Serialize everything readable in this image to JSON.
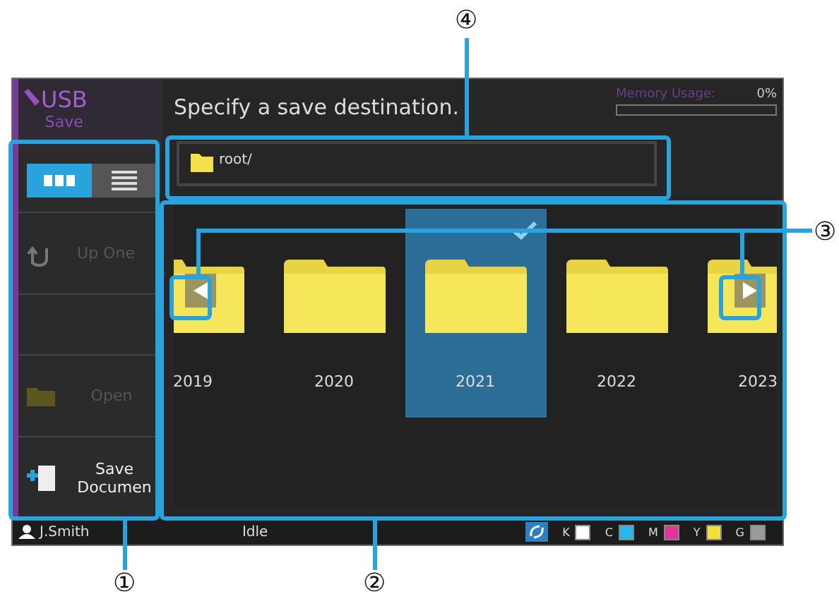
{
  "header": {
    "app_title": "USB",
    "app_subtitle": "Save",
    "prompt": "Specify a save destination.",
    "memory": {
      "label": "Memory Usage:",
      "value": "0%",
      "level": 0
    }
  },
  "view_toggle": [
    {
      "kind": "grid",
      "selected": true
    },
    {
      "kind": "list",
      "selected": false
    }
  ],
  "sidebar": {
    "items": [
      {
        "kind": "up",
        "label": "Up One",
        "disabled": true
      },
      {
        "kind": "open",
        "label": "Open",
        "disabled": true
      },
      {
        "kind": "save",
        "label": "Save Documen",
        "disabled": false
      }
    ]
  },
  "path": "root/",
  "folders": [
    {
      "name": "2019",
      "selected": false
    },
    {
      "name": "2020",
      "selected": false
    },
    {
      "name": "2021",
      "selected": true
    },
    {
      "name": "2022",
      "selected": false
    },
    {
      "name": "2023",
      "selected": false
    }
  ],
  "status_bar": {
    "user": "J.Smith",
    "status": "Idle",
    "toners": [
      {
        "label": "K",
        "color": "#ffffff"
      },
      {
        "label": "C",
        "color": "#29b6e8"
      },
      {
        "label": "M",
        "color": "#e0359a"
      },
      {
        "label": "Y",
        "color": "#f2df3a"
      },
      {
        "label": "G",
        "color": "#9a9a9a"
      }
    ]
  },
  "callouts": [
    {
      "label": "④"
    },
    {
      "label": "③"
    },
    {
      "label": "①"
    },
    {
      "label": "②"
    }
  ]
}
